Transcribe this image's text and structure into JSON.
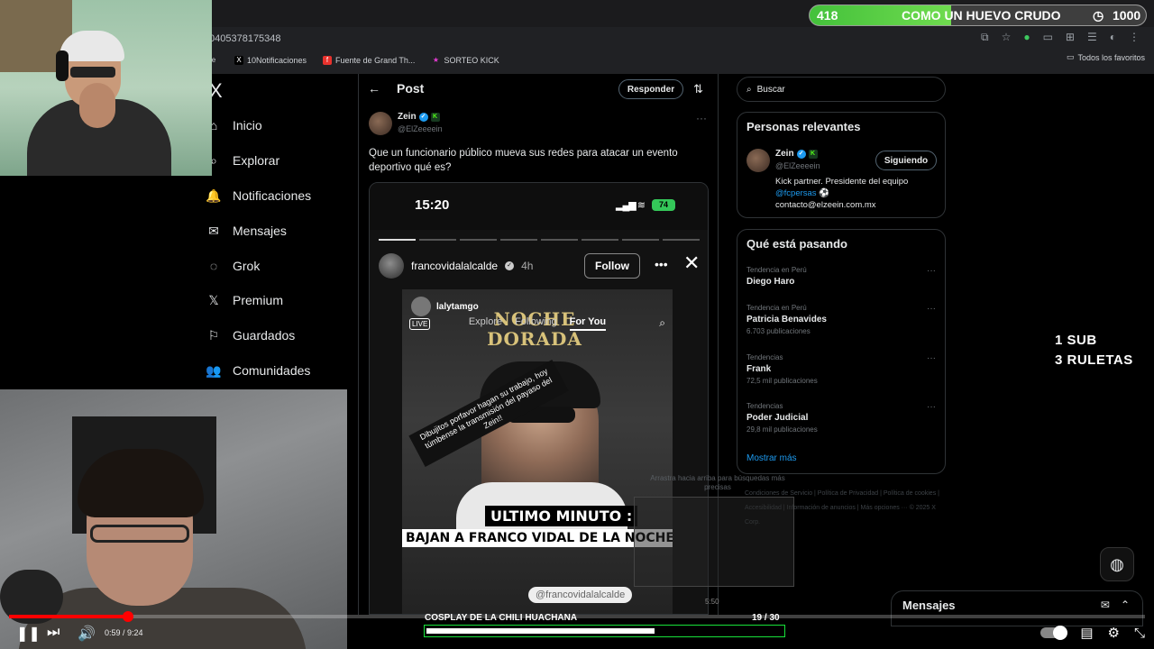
{
  "browser": {
    "url": "0405378175348",
    "bookmarks": [
      {
        "label": "",
        "icon": "e"
      },
      {
        "label": "10Notificaciones",
        "icon": "X"
      },
      {
        "label": "Fuente de Grand Th...",
        "icon": "f"
      },
      {
        "label": "SORTEO KICK",
        "icon": "★"
      }
    ],
    "favorites_label": "Todos los favoritos"
  },
  "overlay": {
    "goal_current": "418",
    "goal_title": "COMO UN HUEVO CRUDO",
    "goal_target": "1000",
    "goal_progress": 0.42,
    "sub_line1": "1 SUB",
    "sub_line2": "3 RULETAS",
    "cosplay_title": "COSPLAY DE LA CHILI HUACHANA",
    "cosplay_count": "19  / 30",
    "cosplay_progress": 0.633
  },
  "nav": {
    "logo": "X",
    "items": [
      {
        "label": "Inicio",
        "icon": "home-icon",
        "glyph": "⌂"
      },
      {
        "label": "Explorar",
        "icon": "search-icon",
        "glyph": "⌕"
      },
      {
        "label": "Notificaciones",
        "icon": "bell-icon",
        "glyph": "🔔"
      },
      {
        "label": "Mensajes",
        "icon": "mail-icon",
        "glyph": "✉"
      },
      {
        "label": "Grok",
        "icon": "grok-icon",
        "glyph": "◌"
      },
      {
        "label": "Premium",
        "icon": "x-premium-icon",
        "glyph": "𝕏"
      },
      {
        "label": "Guardados",
        "icon": "bookmark-icon",
        "glyph": "⚐"
      },
      {
        "label": "Comunidades",
        "icon": "communities-icon",
        "glyph": "👥"
      }
    ]
  },
  "post": {
    "header": "Post",
    "reply_button": "Responder",
    "author_name": "Zein",
    "author_handle": "@ElZeeeein",
    "text": "Que un funcionario público mueva sus redes para atacar un evento deportivo qué es?",
    "media": {
      "time": "15:20",
      "battery": "74",
      "story_user": "francovidalalcalde",
      "story_time": "4h",
      "follow_label": "Follow",
      "inner_user": "lalytamgo",
      "nav_explore": "Explore",
      "nav_following": "Following",
      "nav_foryou": "For You",
      "live_label": "LIVE",
      "title_line1": "NOCHE",
      "title_line2": "DORADA",
      "diag_note": "Dibujitos porfavor hagan su trabajo, hoy túmbense la transmisión del payaso del Zein!!",
      "breaking1": "ULTIMO MINUTO :",
      "breaking2": "BAJAN A FRANCO VIDAL DE LA NOCHE DORADA",
      "tag": "@francovidalalcalde"
    }
  },
  "sidebar": {
    "search_placeholder": "Buscar",
    "relevant_title": "Personas relevantes",
    "relevant_name": "Zein",
    "relevant_handle": "@ElZeeeein",
    "following_label": "Siguiendo",
    "bio_line1": "Kick partner. Presidente del equipo",
    "bio_link": "@fcpersas",
    "bio_email": "contacto@elzeein.com.mx",
    "trends_title": "Qué está pasando",
    "trends": [
      {
        "category": "Tendencia en Perú",
        "name": "Diego Haro",
        "count": ""
      },
      {
        "category": "Tendencia en Perú",
        "name": "Patricia Benavides",
        "count": "6.703 publicaciones"
      },
      {
        "category": "Tendencias",
        "name": "Frank",
        "count": "72,5 mil publicaciones"
      },
      {
        "category": "Tendencias",
        "name": "Poder Judicial",
        "count": "29,8 mil publicaciones"
      }
    ],
    "show_more": "Mostrar más",
    "swipe_note": "Arrastra hacia arriba para búsquedas más precisas",
    "footer": "Condiciones de Servicio | Política de Privacidad | Política de cookies | Accesibilidad | Información de anuncios | Más opciones ··· © 2025 X Corp.",
    "mini_time": "5:50",
    "messages_title": "Mensajes"
  },
  "player": {
    "time": "0:59 / 9:24",
    "progress": 0.105
  }
}
